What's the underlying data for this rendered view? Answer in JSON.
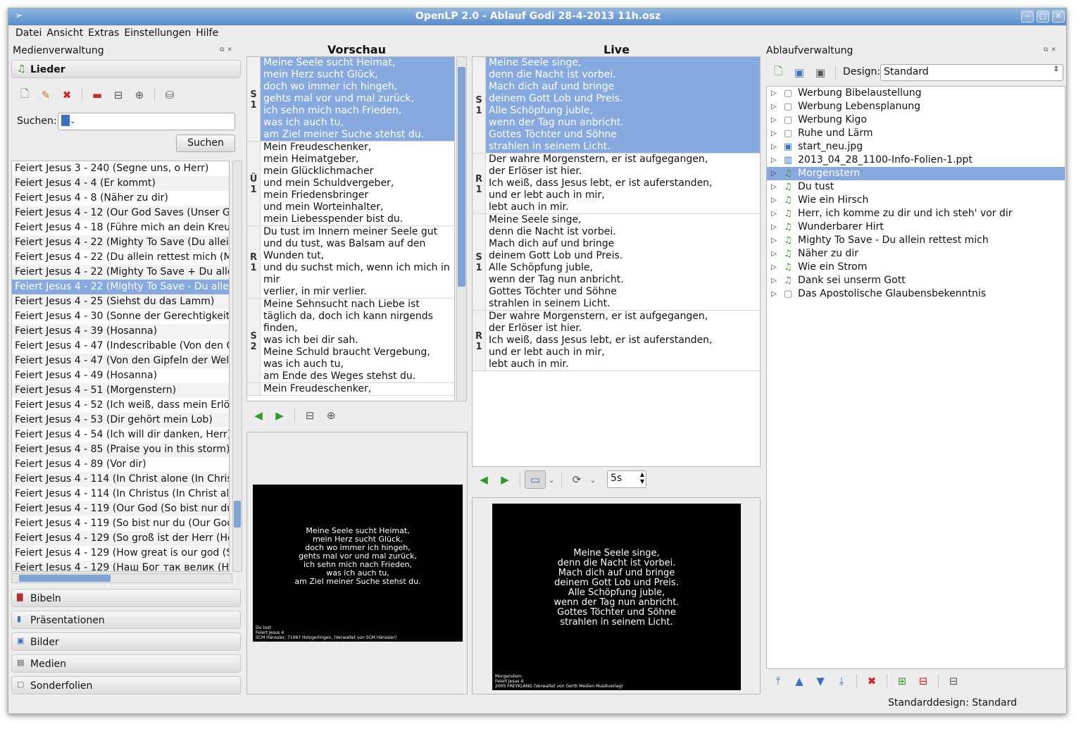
{
  "window": {
    "title": "OpenLP 2.0 - Ablauf Godi 28-4-2013 11h.osz"
  },
  "menu": [
    "Datei",
    "Ansicht",
    "Extras",
    "Einstellungen",
    "Hilfe"
  ],
  "media_manager": {
    "title": "Medienverwaltung",
    "songs_section": "Lieder",
    "search_label": "Suchen:",
    "search_button": "Suchen",
    "songs": [
      "Feiert Jesus 3 - 240 (Segne uns, o Herr)",
      "Feiert Jesus 4 - 4 (Er kommt)",
      "Feiert Jesus 4 - 8 (Näher zu dir)",
      "Feiert Jesus 4 - 12 (Our God Saves (Unser Gott",
      "Feiert Jesus 4 - 18 (Führe mich an dein Kreuz (L",
      "Feiert Jesus 4 - 22 (Mighty To Save (Du allein re",
      "Feiert Jesus 4 - 22 (Du allein rettest mich (Migh",
      "Feiert Jesus 4 - 22 (Mighty To Save + Du allein",
      "Feiert Jesus 4 - 22 (Mighty To Save - Du allein r",
      "Feiert Jesus 4 - 25 (Siehst du das Lamm)",
      "Feiert Jesus 4 - 30 (Sonne der Gerechtigkeit)",
      "Feiert Jesus 4 - 39 (Hosanna)",
      "Feiert Jesus 4 - 47 (Indescribable (Von den Gipf",
      "Feiert Jesus 4 - 47 (Von den Gipfeln der Welt (Ir",
      "Feiert Jesus 4 - 49 (Hosanna)",
      "Feiert Jesus 4 - 51 (Morgenstern)",
      "Feiert Jesus 4 - 52 (Ich weiß, dass mein Erlöser",
      "Feiert Jesus 4 - 53 (Dir gehört mein Lob)",
      "Feiert Jesus 4 - 54 (Ich will dir danken, Herr)",
      "Feiert Jesus 4 - 85 (Praise you in this storm)",
      "Feiert Jesus 4 - 89 (Vor dir)",
      "Feiert Jesus 4 - 114 (In Christ alone (In Christus",
      "Feiert Jesus 4 - 114 (In Christus (In Christ alone",
      "Feiert Jesus 4 - 119 (Our God (So bist nur du))",
      "Feiert Jesus 4 - 119 (So bist nur du (Our God))",
      "Feiert Jesus 4 - 129 (So groß ist der Herr (How g",
      "Feiert Jesus 4 - 129 (How great is our god  (So g",
      "Feiert Jesus 4 - 129 (Наш Бог так велик (How"
    ],
    "selected_song_index": 8,
    "other_sections": [
      "Bibeln",
      "Präsentationen",
      "Bilder",
      "Medien",
      "Sonderfolien"
    ]
  },
  "preview": {
    "title": "Vorschau",
    "slides": [
      {
        "tag": [
          "S",
          "1"
        ],
        "text": "Meine Seele sucht Heimat,\nmein Herz sucht Glück,\ndoch wo immer ich hingeh,\ngehts mal vor und mal zurück,\nich sehn mich nach Frieden,\nwas ich auch tu,\nam Ziel meiner Suche stehst du."
      },
      {
        "tag": [
          "Ü",
          "1"
        ],
        "text": "Mein Freudeschenker,\nmein Heimatgeber,\nmein Glücklichmacher\nund mein Schuldvergeber,\nmein Friedensbringer\nund mein Worteinhalter,\nmein Liebesspender bist du."
      },
      {
        "tag": [
          "R",
          "1"
        ],
        "text": "Du tust im Innern meiner Seele gut\nund du tust, was Balsam auf den\nWunden tut,\nund du suchst mich, wenn ich mich in\nmir\nverlier, in mir verlier."
      },
      {
        "tag": [
          "S",
          "2"
        ],
        "text": "Meine Sehnsucht nach Liebe ist\ntäglich da, doch ich kann nirgends\nfinden,\nwas ich bei dir sah.\nMeine Schuld braucht Vergebung,\nwas ich auch tu,\nam Ende des Weges stehst du."
      },
      {
        "tag": [
          "",
          ""
        ],
        "text": "Mein Freudeschenker,"
      }
    ],
    "screen_text": "Meine Seele sucht Heimat,\nmein Herz sucht Glück,\ndoch wo immer ich hingeh,\ngehts mal vor und mal zurück,\nich sehn mich nach Frieden,\nwas ich auch tu,\nam Ziel meiner Suche stehst du.",
    "screen_footer": "Du tust\nFeiert Jesus 4\nSCM Hänssler, 71087 Holzgerlingen, (Verwaltet von SCM Hänssler)"
  },
  "live": {
    "title": "Live",
    "slides": [
      {
        "tag": [
          "S",
          "1"
        ],
        "text": "Meine Seele singe,\ndenn die Nacht ist vorbei.\nMach dich auf und bringe\ndeinem Gott Lob und Preis.\nAlle Schöpfung juble,\nwenn der Tag nun anbricht.\nGottes Töchter und Söhne\nstrahlen in seinem Licht."
      },
      {
        "tag": [
          "R",
          "1"
        ],
        "text": "Der wahre Morgenstern, er ist aufgegangen,\nder Erlöser ist hier.\nIch weiß, dass Jesus lebt, er ist auferstanden,\nund er lebt auch in mir,\nlebt auch in mir."
      },
      {
        "tag": [
          "S",
          "1"
        ],
        "text": "Meine Seele singe,\ndenn die Nacht ist vorbei.\nMach dich auf und bringe\ndeinem Gott Lob und Preis.\nAlle Schöpfung juble,\nwenn der Tag nun anbricht.\nGottes Töchter und Söhne\nstrahlen in seinem Licht."
      },
      {
        "tag": [
          "R",
          "1"
        ],
        "text": "Der wahre Morgenstern, er ist aufgegangen,\nder Erlöser ist hier.\nIch weiß, dass Jesus lebt, er ist auferstanden,\nund er lebt auch in mir,\nlebt auch in mir."
      }
    ],
    "delay": "5s",
    "screen_text": "Meine Seele singe,\ndenn die Nacht ist vorbei.\nMach dich auf und bringe\ndeinem Gott Lob und Preis.\nAlle Schöpfung juble,\nwenn der Tag nun anbricht.\nGottes Töchter und Söhne\nstrahlen in seinem Licht.",
    "screen_footer": "Morgenstern\nFeiert Jesus 4\n2005 FREYKLANG (Verwaltet von Gerth Medien Musikverlag)"
  },
  "service": {
    "title": "Ablaufverwaltung",
    "design_label": "Design:",
    "design_value": "Standard",
    "items": [
      {
        "label": "Werbung Bibelaustellung",
        "icon": "custom"
      },
      {
        "label": "Werbung Lebensplanung",
        "icon": "custom"
      },
      {
        "label": "Werbung Kigo",
        "icon": "custom"
      },
      {
        "label": "Ruhe und Lärm",
        "icon": "custom"
      },
      {
        "label": "start_neu.jpg",
        "icon": "image"
      },
      {
        "label": "2013_04_28_1100-Info-Folien-1.ppt",
        "icon": "presentation"
      },
      {
        "label": "Morgenstern",
        "icon": "song"
      },
      {
        "label": "Du tust",
        "icon": "song"
      },
      {
        "label": "Wie ein Hirsch",
        "icon": "song"
      },
      {
        "label": "Herr, ich komme zu dir und ich steh' vor dir",
        "icon": "song"
      },
      {
        "label": "Wunderbarer Hirt",
        "icon": "song"
      },
      {
        "label": "Mighty To Save - Du allein rettest mich",
        "icon": "song"
      },
      {
        "label": "Näher zu dir",
        "icon": "song"
      },
      {
        "label": "Wie ein Strom",
        "icon": "song"
      },
      {
        "label": "Dank sei unserm Gott",
        "icon": "song"
      },
      {
        "label": "Das Apostolische Glaubensbekenntnis",
        "icon": "custom"
      }
    ],
    "selected_index": 6
  },
  "status": "Standarddesign: Standard",
  "colors": {
    "selection": "#86a9e0",
    "title_bar": "#5a8cc9",
    "song_icon": "#3a9a2a",
    "delete": "#d42020"
  }
}
